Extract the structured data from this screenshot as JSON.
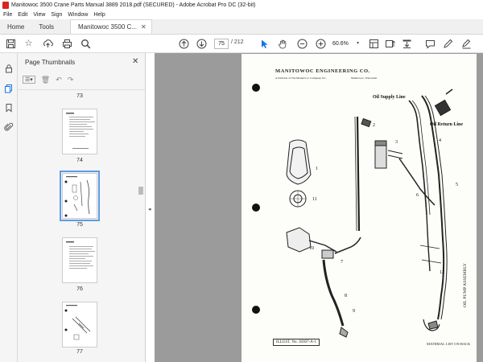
{
  "window": {
    "title": "Manitowoc 3500 Crane Parts Manual 3889 2018.pdf (SECURED) - Adobe Acrobat Pro DC (32-bit)"
  },
  "menu": [
    "File",
    "Edit",
    "View",
    "Sign",
    "Window",
    "Help"
  ],
  "tabs": {
    "home": "Home",
    "tools": "Tools",
    "document": "Manitowoc 3500 C..."
  },
  "toolbar": {
    "current_page": "75",
    "total_pages": "/ 212",
    "zoom": "60.6%"
  },
  "panel": {
    "title": "Page Thumbnails",
    "thumbnails": [
      {
        "label": "73"
      },
      {
        "label": "74"
      },
      {
        "label": "75"
      },
      {
        "label": "76"
      },
      {
        "label": "77"
      }
    ]
  },
  "document_page": {
    "header": "MANITOWOC ENGINEERING CO.",
    "subheader_left": "A Division of The Manitowoc Company, Inc.",
    "subheader_right": "Manitowoc, Wisconsin",
    "label_supply": "Oil Supply Line",
    "label_return": "Oil Return Line",
    "callouts": [
      "1",
      "2",
      "3",
      "4",
      "5",
      "6",
      "7",
      "8",
      "9",
      "10",
      "11",
      "12"
    ],
    "illust": "ILLUST. No. 30307-A-1",
    "material_list": "MATERIAL LIST ON BACK",
    "side_title": "OIL PUMP ASSEMBLY"
  },
  "colors": {
    "accent": "#1473e6",
    "acrobat_red": "#d9231f",
    "doc_background": "#9b9b9b"
  }
}
